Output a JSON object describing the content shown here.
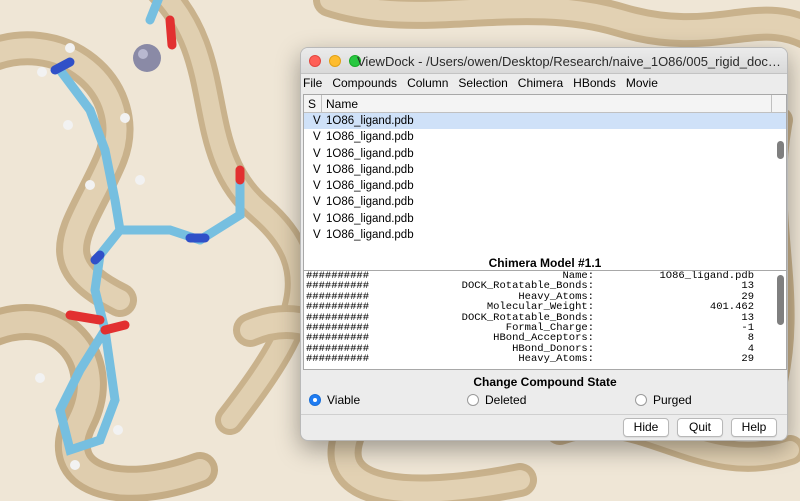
{
  "window": {
    "title": "ViewDock - /Users/owen/Desktop/Research/naive_1O86/005_rigid_dock/1O86...",
    "menu": [
      "File",
      "Compounds",
      "Column",
      "Selection",
      "Chimera",
      "HBonds",
      "Movie"
    ]
  },
  "list": {
    "col_s": "S",
    "col_name": "Name",
    "rows": [
      {
        "state": "V",
        "name": "1O86_ligand.pdb"
      },
      {
        "state": "V",
        "name": "1O86_ligand.pdb"
      },
      {
        "state": "V",
        "name": "1O86_ligand.pdb"
      },
      {
        "state": "V",
        "name": "1O86_ligand.pdb"
      },
      {
        "state": "V",
        "name": "1O86_ligand.pdb"
      },
      {
        "state": "V",
        "name": "1O86_ligand.pdb"
      },
      {
        "state": "V",
        "name": "1O86_ligand.pdb"
      },
      {
        "state": "V",
        "name": "1O86_ligand.pdb"
      }
    ]
  },
  "model": {
    "title": "Chimera Model #1.1",
    "rows": [
      {
        "hash": "##########",
        "key": "Name:",
        "value": "1O86_ligand.pdb"
      },
      {
        "hash": "##########",
        "key": "DOCK_Rotatable_Bonds:",
        "value": "13"
      },
      {
        "hash": "##########",
        "key": "Heavy_Atoms:",
        "value": "29"
      },
      {
        "hash": "##########",
        "key": "Molecular_Weight:",
        "value": "401.462"
      },
      {
        "hash": "##########",
        "key": "DOCK_Rotatable_Bonds:",
        "value": "13"
      },
      {
        "hash": "##########",
        "key": "Formal_Charge:",
        "value": "-1"
      },
      {
        "hash": "##########",
        "key": "HBond_Acceptors:",
        "value": "8"
      },
      {
        "hash": "##########",
        "key": "HBond_Donors:",
        "value": "4"
      },
      {
        "hash": "##########",
        "key": "Heavy_Atoms:",
        "value": "29"
      }
    ]
  },
  "state": {
    "title": "Change Compound State",
    "viable": "Viable",
    "deleted": "Deleted",
    "purged": "Purged"
  },
  "buttons": {
    "hide": "Hide",
    "quit": "Quit",
    "help": "Help"
  }
}
